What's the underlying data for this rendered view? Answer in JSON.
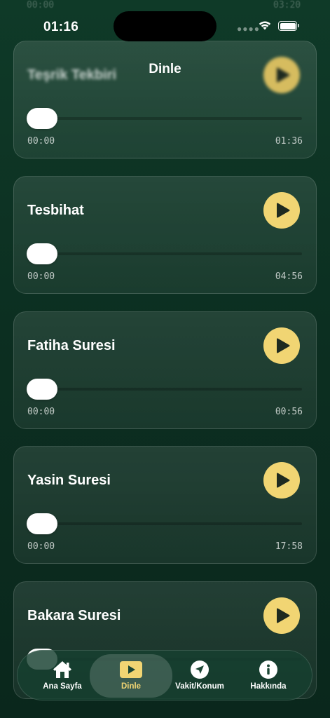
{
  "status_bar": {
    "time": "01:16"
  },
  "nav": {
    "title": "Dinle"
  },
  "ghost_times": {
    "current": "00:00",
    "duration": "03:20"
  },
  "tracks": [
    {
      "title": "Teşrik Tekbiri",
      "current": "00:00",
      "duration": "01:36",
      "progress": 0
    },
    {
      "title": "Tesbihat",
      "current": "00:00",
      "duration": "04:56",
      "progress": 0
    },
    {
      "title": "Fatiha Suresi",
      "current": "00:00",
      "duration": "00:56",
      "progress": 0
    },
    {
      "title": "Yasin Suresi",
      "current": "00:00",
      "duration": "17:58",
      "progress": 0
    },
    {
      "title": "Bakara Suresi",
      "current": "",
      "duration": "",
      "progress": 0
    }
  ],
  "tabbar": {
    "items": [
      {
        "label": "Ana Sayfa",
        "icon": "house-icon",
        "active": false
      },
      {
        "label": "Dinle",
        "icon": "play-rectangle-icon",
        "active": true
      },
      {
        "label": "Vakit/Konum",
        "icon": "location-arrow-icon",
        "active": false
      },
      {
        "label": "Hakkında",
        "icon": "info-circle-icon",
        "active": false
      }
    ]
  },
  "colors": {
    "accent": "#f1d573",
    "background": "#0f3a28"
  }
}
